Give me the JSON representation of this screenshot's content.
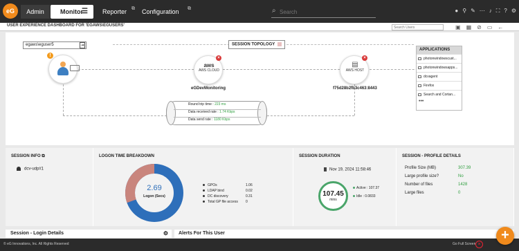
{
  "nav": {
    "logo": "eG",
    "tabs": [
      {
        "label": "Admin"
      },
      {
        "label": "Monitor"
      },
      {
        "label": "Reporter"
      },
      {
        "label": "Configuration"
      }
    ],
    "search_placeholder": "Search",
    "icons": [
      "user-icon",
      "link-icon",
      "wrench-icon",
      "ellipsis-icon",
      "bell-icon",
      "maximize-icon",
      "help-icon",
      "settings-icon"
    ]
  },
  "page": {
    "title": "USER EXPERIENCE DASHBOARD FOR 'EGAWS\\EGUSERS'",
    "search_users_placeholder": "Search Users"
  },
  "topology": {
    "title": "SESSION TOPOLOGY",
    "user_box": "egaws\\eguser5",
    "cloud_name": "eGDevMonitoring",
    "cloud_logo": "aws",
    "cloud_sub": "AWS CLOUD",
    "host_name": "f75d28b2fb3c463:8443",
    "host_sub": "AWS HOST",
    "round_trip_label": "Round trip time :",
    "round_trip_value": "223 ms",
    "received_label": "Data received rate :",
    "received_value": "1.74 Kbps",
    "send_label": "Data send rate :",
    "send_value": "1180 Kbps"
  },
  "applications": {
    "title": "APPLICATIONS",
    "items": [
      "photonwindowscust...",
      "photonwindowsapps...",
      "dcvagent",
      "Firefox",
      "Search and Cortan..."
    ],
    "more": "•••"
  },
  "session_info": {
    "title": "SESSION INFO",
    "user": "dcv-udp#1"
  },
  "logon": {
    "title": "LOGON TIME BREAKDOWN",
    "total_value": "2.69",
    "total_label": "Logon (Secs)",
    "items": [
      {
        "label": "GPOs",
        "value": "1.06"
      },
      {
        "label": "LDAP bind",
        "value": "0.02"
      },
      {
        "label": "DC discovery",
        "value": "0.31"
      },
      {
        "label": "Total GP file access",
        "value": "0"
      }
    ]
  },
  "duration": {
    "title": "SESSION DURATION",
    "date": "Nov 19, 2024 11:58:46",
    "value": "107.45",
    "unit": "mins",
    "active_label": "Active :",
    "active_value": "107.37",
    "idle_label": "Idle :",
    "idle_value": "0.0833"
  },
  "profile": {
    "title": "SESSION - PROFILE DETAILS",
    "rows": [
      {
        "label": "Profile Size (MB)",
        "value": "307.39"
      },
      {
        "label": "Large profile size?",
        "value": "No"
      },
      {
        "label": "Number of files",
        "value": "1428"
      },
      {
        "label": "Large files",
        "value": "0"
      }
    ]
  },
  "bottom": {
    "login_details": "Session - Login Details",
    "alerts": "Alerts For This User"
  },
  "footer": {
    "copyright": "© eG Innovations, Inc. All Rights Reserved",
    "full_screen": "Go Full Screen"
  },
  "fab": "+"
}
